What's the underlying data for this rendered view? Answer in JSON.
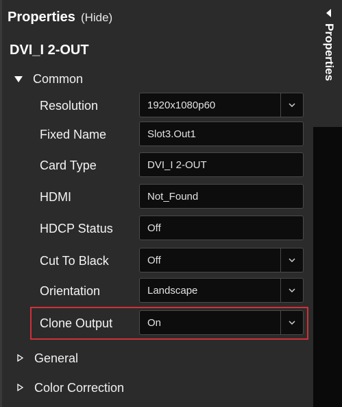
{
  "header": {
    "title": "Properties",
    "hide_label": "(Hide)"
  },
  "device_name": "DVI_I 2-OUT",
  "sections": {
    "common": "Common",
    "general": "General",
    "color_correction": "Color Correction"
  },
  "rows": [
    {
      "label": "Resolution",
      "value": "1920x1080p60",
      "dropdown": true
    },
    {
      "label": "Fixed Name",
      "value": "Slot3.Out1",
      "dropdown": false
    },
    {
      "label": "Card Type",
      "value": "DVI_I 2-OUT",
      "dropdown": false
    },
    {
      "label": "HDMI",
      "value": "Not_Found",
      "dropdown": false
    },
    {
      "label": "HDCP Status",
      "value": "Off",
      "dropdown": false
    },
    {
      "label": "Cut To Black",
      "value": "Off",
      "dropdown": true
    },
    {
      "label": "Orientation",
      "value": "Landscape",
      "dropdown": true
    },
    {
      "label": "Clone Output",
      "value": "On",
      "dropdown": true
    }
  ],
  "side_tab": {
    "label": "Properties"
  },
  "colors": {
    "panel_bg": "#2b2b2b",
    "field_bg": "#0d0d0d",
    "highlight": "#d0313a"
  }
}
